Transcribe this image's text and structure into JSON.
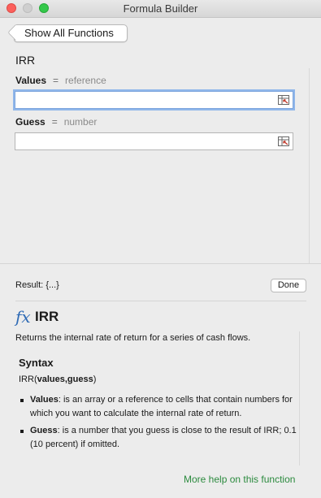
{
  "window": {
    "title": "Formula Builder"
  },
  "nav": {
    "back_label": "Show All Functions"
  },
  "function": {
    "name": "IRR"
  },
  "arguments": [
    {
      "label": "Values",
      "equals": "=",
      "type": "reference",
      "value": ""
    },
    {
      "label": "Guess",
      "equals": "=",
      "type": "number",
      "value": ""
    }
  ],
  "footer": {
    "result_label": "Result:",
    "result_value": "{...}",
    "done_label": "Done"
  },
  "help": {
    "title": "IRR",
    "description": "Returns the internal rate of return for a series of cash flows.",
    "syntax_heading": "Syntax",
    "syntax_fn": "IRR(",
    "syntax_args": "values,guess",
    "syntax_close": ")",
    "bullets": [
      {
        "term": "Values",
        "text": ": is an array or a reference to cells that contain numbers for which you want to calculate the internal rate of return."
      },
      {
        "term": "Guess",
        "text": ": is a number that you guess is close to the result of IRR; 0.1 (10 percent) if omitted."
      }
    ],
    "more_link": "More help on this function"
  },
  "icons": {
    "fx": "fx-icon",
    "reference": "cell-reference-icon",
    "back": "chevron-left-icon"
  },
  "colors": {
    "link": "#2b8a3e",
    "fx": "#2f6bb5",
    "focus": "#8fb6ea"
  }
}
